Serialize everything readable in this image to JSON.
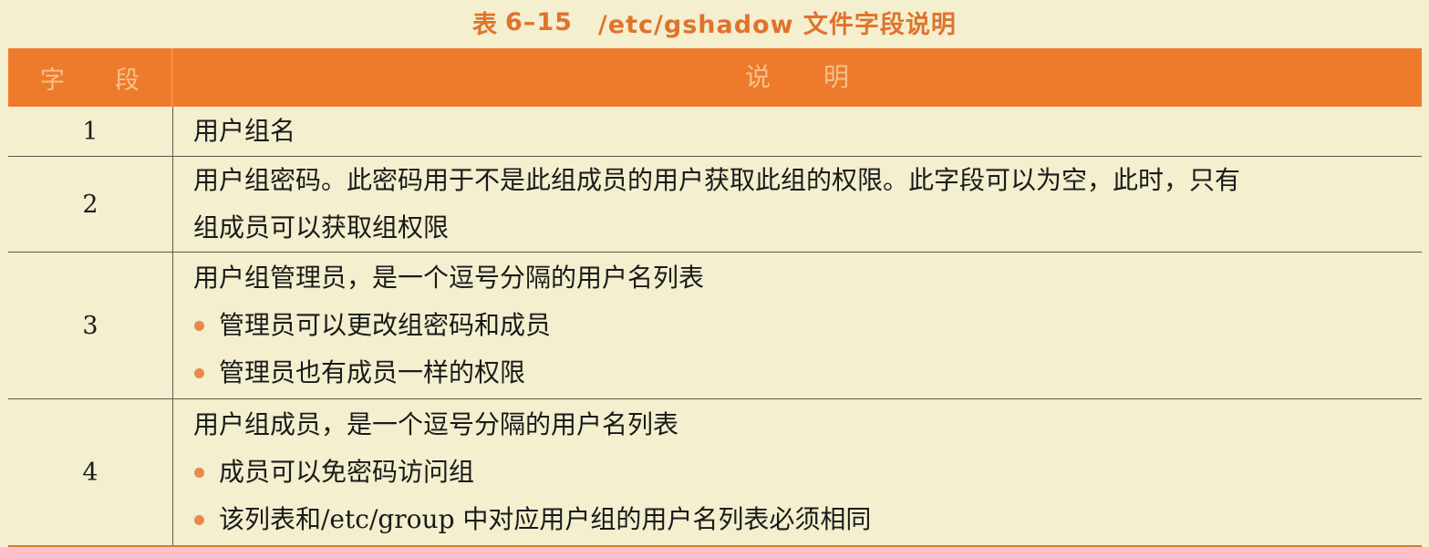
{
  "caption": {
    "label": "表",
    "number": "6–15",
    "title": "/etc/gshadow 文件字段说明"
  },
  "header": {
    "field_chars": [
      "字",
      "段"
    ],
    "desc_chars": [
      "说",
      "明"
    ]
  },
  "rows": [
    {
      "field": "1",
      "lines": [
        "用户组名"
      ],
      "bullets": []
    },
    {
      "field": "2",
      "lines": [
        "用户组密码。此密码用于不是此组成员的用户获取此组的权限。此字段可以为空，此时，只有",
        "组成员可以获取组权限"
      ],
      "bullets": []
    },
    {
      "field": "3",
      "lines": [
        "用户组管理员，是一个逗号分隔的用户名列表"
      ],
      "bullets": [
        "管理员可以更改组密码和成员",
        "管理员也有成员一样的权限"
      ]
    },
    {
      "field": "4",
      "lines": [
        "用户组成员，是一个逗号分隔的用户名列表"
      ],
      "bullets": [
        "成员可以免密码访问组",
        "该列表和/etc/group 中对应用户组的用户名列表必须相同"
      ]
    }
  ],
  "colors": {
    "header_bg": "#ee7a2c",
    "caption": "#e0732c",
    "page_bg": "#f3efcf",
    "bullet": "#e98a48"
  }
}
